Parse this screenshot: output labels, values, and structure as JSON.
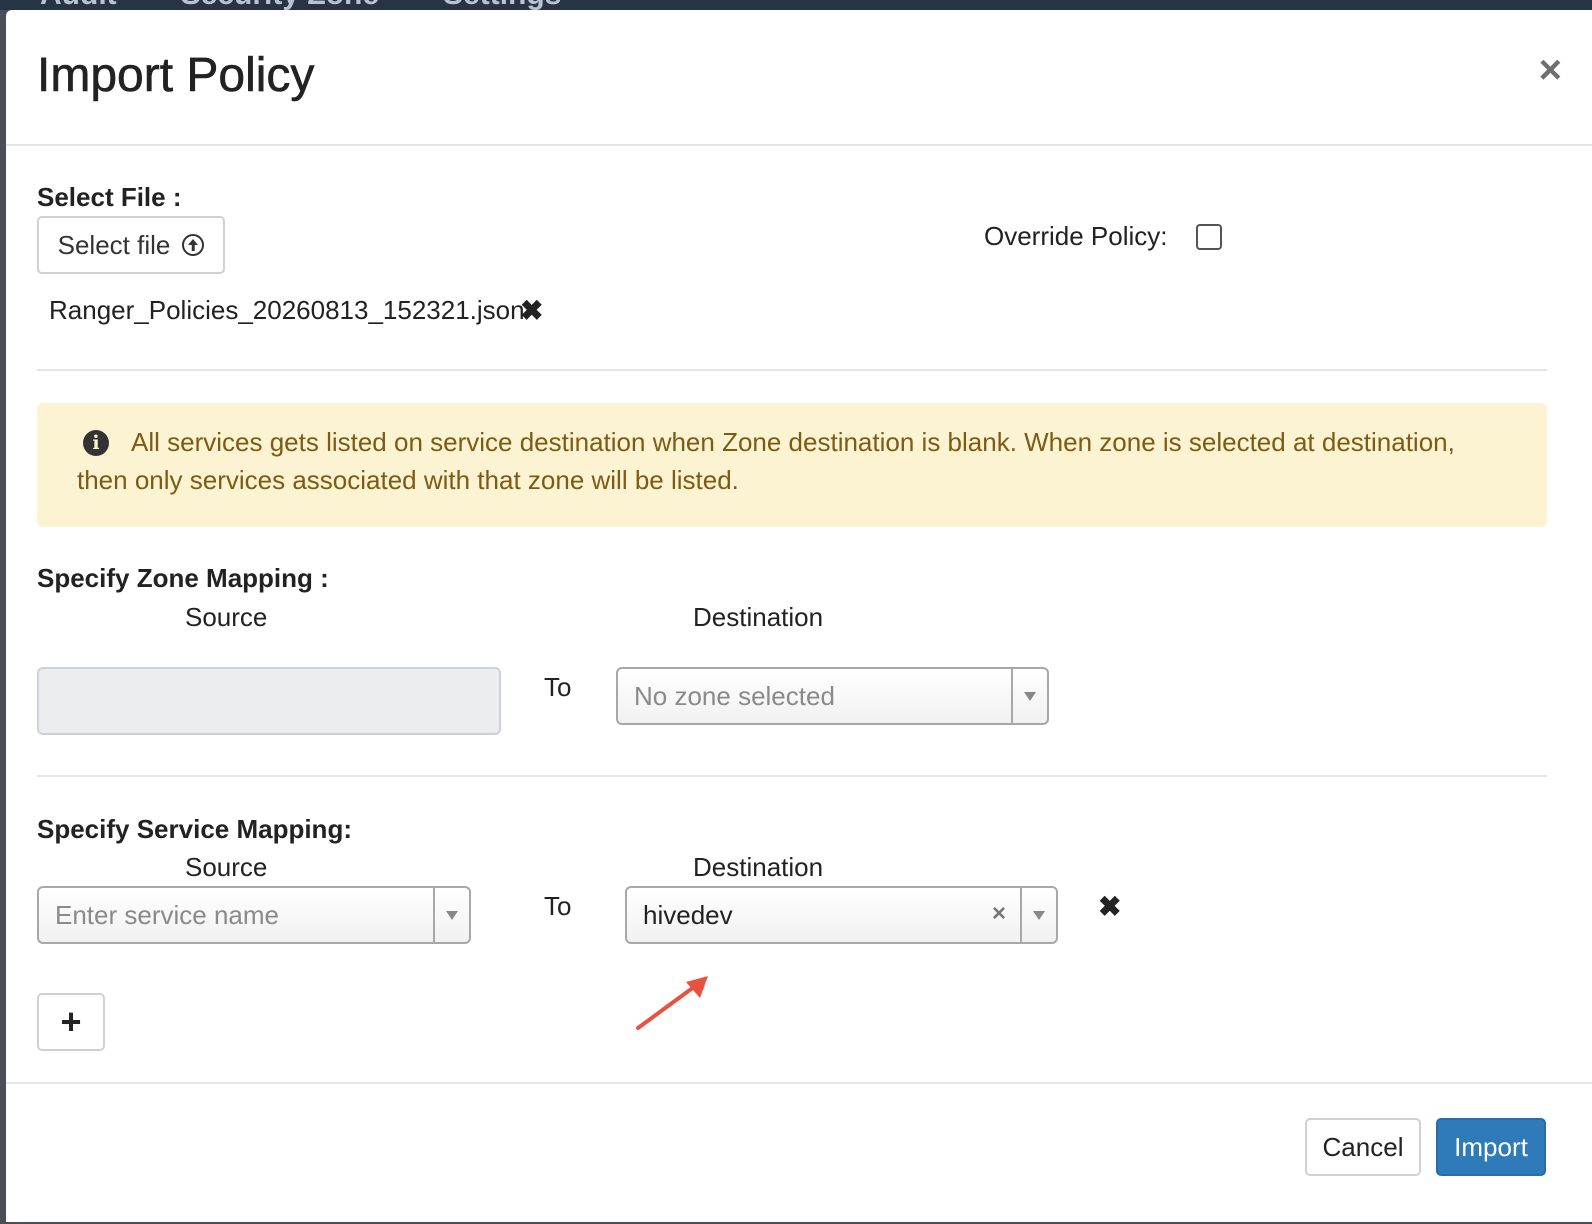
{
  "background_nav": {
    "items": [
      "Audit",
      "Security Zone",
      "Settings"
    ]
  },
  "modal": {
    "title": "Import Policy",
    "close_glyph": "×"
  },
  "select_file": {
    "label": "Select File :",
    "button_label": "Select file",
    "file_name": "Ranger_Policies_20260813_152321.json",
    "remove_glyph": "✖"
  },
  "override_policy": {
    "label": "Override Policy:",
    "checked": false
  },
  "alert": {
    "icon": "info-icon",
    "text": "All services gets listed on service destination when Zone destination is blank. When zone is selected at destination, then only services associated with that zone will be listed."
  },
  "zone_mapping": {
    "heading": "Specify Zone Mapping :",
    "source_header": "Source",
    "destination_header": "Destination",
    "to_label": "To",
    "source_value": "",
    "destination_placeholder": "No zone selected"
  },
  "service_mapping": {
    "heading": "Specify Service Mapping:",
    "source_header": "Source",
    "destination_header": "Destination",
    "to_label": "To",
    "source_placeholder": "Enter service name",
    "destination_value": "hivedev",
    "clear_glyph": "×",
    "remove_row_glyph": "✖",
    "add_row_label": "+"
  },
  "footer": {
    "cancel_label": "Cancel",
    "import_label": "Import"
  },
  "colors": {
    "primary": "#2f7ab8",
    "alert_bg": "#fcf3d3",
    "alert_text": "#7d5b12",
    "annotation_arrow": "#e8533f"
  }
}
